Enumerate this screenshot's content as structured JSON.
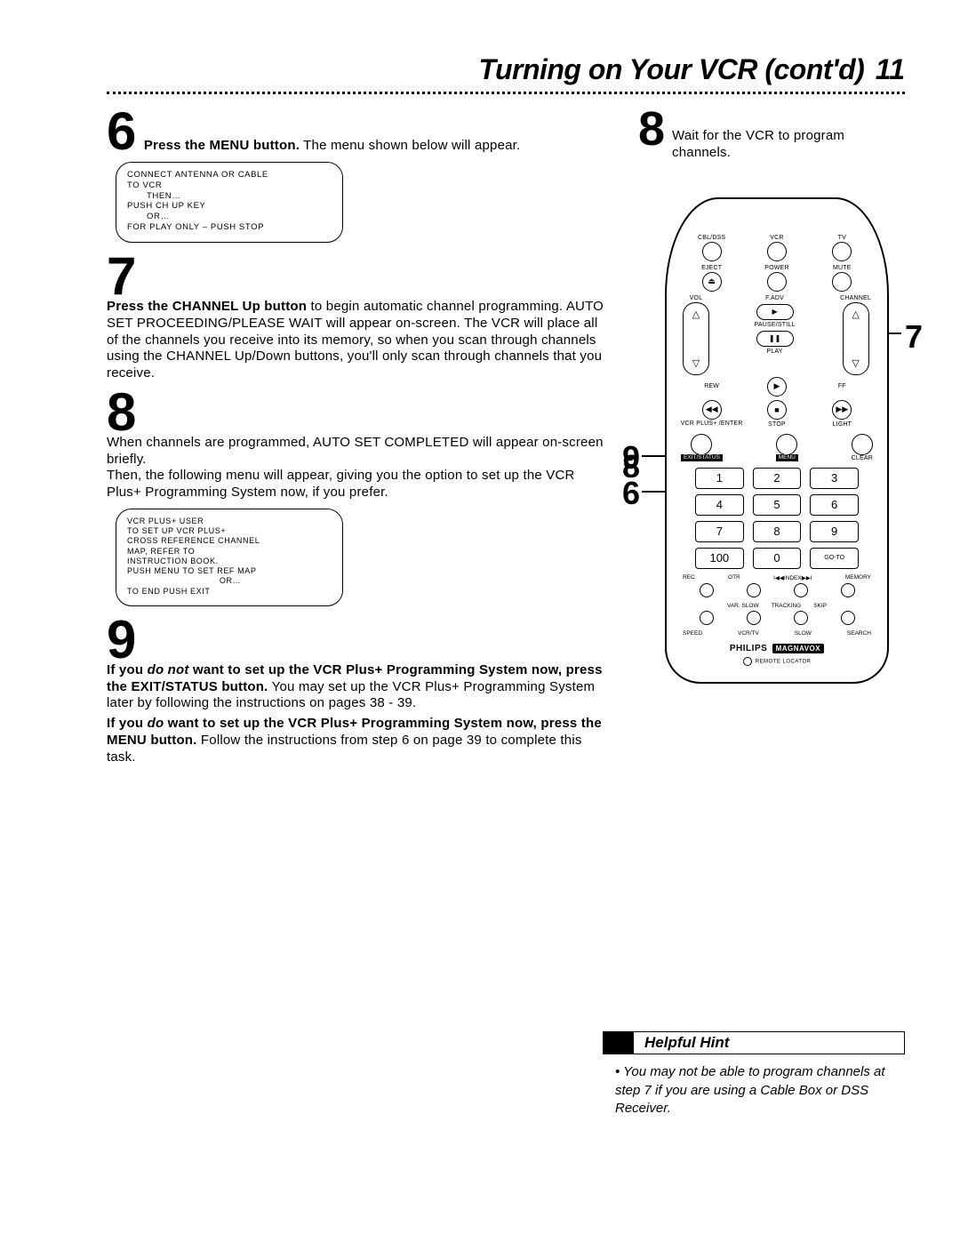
{
  "header": {
    "title": "Turning on Your VCR (cont'd)",
    "page": "11"
  },
  "left": {
    "step6": {
      "num": "6",
      "bold": "Press the MENU button.",
      "rest": " The menu shown below will appear.",
      "menu": {
        "l1": "CONNECT ANTENNA OR CABLE",
        "l2": "TO VCR",
        "l3": "THEN…",
        "l4": "PUSH CH UP KEY",
        "l5": "OR…",
        "l6": "FOR PLAY ONLY – PUSH STOP"
      }
    },
    "step7": {
      "num": "7",
      "bold": "Press the CHANNEL Up button",
      "rest": " to begin automatic channel programming. AUTO SET PROCEEDING/PLEASE WAIT will appear on-screen. The VCR will place all of the channels you receive into its memory, so when you scan through channels using the CHANNEL Up/Down buttons, you'll only scan through channels that you receive."
    },
    "step8": {
      "num": "8",
      "p1": "When channels are programmed, AUTO SET COMPLETED will appear on-screen briefly.",
      "p2": "Then, the following menu will appear, giving you the option to set up the VCR Plus+ Programming System now, if you prefer.",
      "menu": {
        "l1": "VCR PLUS+ USER",
        "l2": "TO SET UP VCR PLUS+",
        "l3": "CROSS REFERENCE CHANNEL",
        "l4": "MAP, REFER TO",
        "l5": "INSTRUCTION BOOK.",
        "l6": "PUSH MENU TO SET REF MAP",
        "l7": "OR…",
        "l8": "TO END PUSH EXIT"
      }
    },
    "step9": {
      "num": "9",
      "p1a": "If you ",
      "p1b": "do not",
      "p1c": " want to set up the VCR Plus+ Programming System now, press the EXIT/STATUS button.",
      "p1d": " You may set up the VCR Plus+ Programming System later by following the instructions on pages 38 - 39.",
      "p2a": "If you ",
      "p2b": "do",
      "p2c": " want to set up the VCR Plus+ Programming System now, press the MENU button.",
      "p2d": " Follow the instructions from step 6 on page 39 to complete this task."
    }
  },
  "right": {
    "step8": {
      "num": "8",
      "text": "Wait for the VCR to program channels."
    }
  },
  "remote": {
    "row1": {
      "a": "CBL/DSS",
      "b": "VCR",
      "c": "TV"
    },
    "row2": {
      "a": "EJECT",
      "b": "POWER",
      "c": "MUTE"
    },
    "vol": "VOL",
    "channel": "CHANNEL",
    "fadv": "F.ADV",
    "pausestill": "PAUSE/STILL",
    "play": "PLAY",
    "transport": {
      "rew": "REW",
      "ff": "FF"
    },
    "vcrplus": "VCR PLUS+\n/ENTER",
    "stop": "STOP",
    "light": "LIGHT",
    "status_row": {
      "a": "EXIT/STATUS",
      "b": "MENU",
      "c": "CLEAR"
    },
    "keys": [
      "1",
      "2",
      "3",
      "4",
      "5",
      "6",
      "7",
      "8",
      "9",
      "100",
      "0",
      "GO-TO"
    ],
    "lower1": {
      "a": "REC",
      "b": "OTR",
      "c": "I◀◀INDEX▶▶I",
      "d": "MEMORY"
    },
    "lower2": {
      "a": "VAR. SLOW",
      "b": "TRACKING",
      "c": "SKIP"
    },
    "lower3": {
      "a": "SPEED",
      "b": "VCR/TV",
      "c": "SLOW",
      "d": "SEARCH"
    },
    "brand": "PHILIPS",
    "brand2": "MAGNAVOX",
    "locator": "REMOTE LOCATOR"
  },
  "callouts": {
    "c7": "7",
    "c8": "8",
    "c9": "9",
    "c6": "6"
  },
  "hint": {
    "title": "Helpful Hint",
    "bullet": "•",
    "body": "You may not be able to program channels at step 7 if you are using a Cable Box or DSS Receiver."
  }
}
